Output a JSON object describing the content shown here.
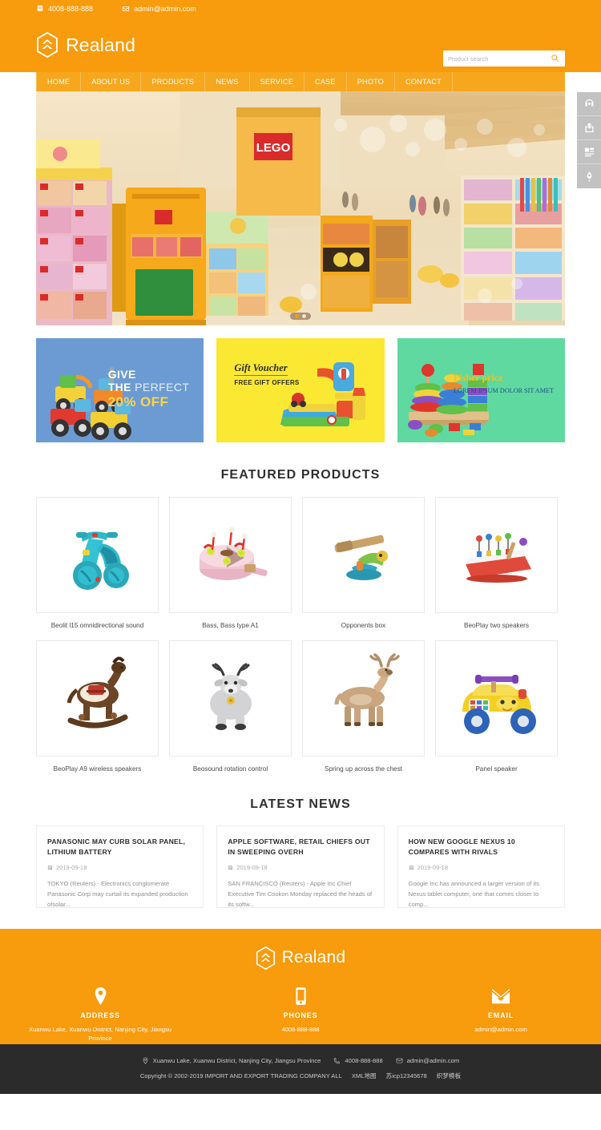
{
  "topbar": {
    "phone": "4008-888-888",
    "email": "admin@admin.com",
    "phone_icon": "telephone-icon",
    "email_icon": "envelope-icon"
  },
  "header": {
    "brand_name": "Realand",
    "logo_icon": "realand-shield-logo",
    "search": {
      "placeholder": "Product search",
      "value": "",
      "button_icon": "search-icon"
    }
  },
  "nav": {
    "items": [
      {
        "label": "HOME"
      },
      {
        "label": "ABOUT US"
      },
      {
        "label": "PRODUCTS"
      },
      {
        "label": "NEWS"
      },
      {
        "label": "SERVICE"
      },
      {
        "label": "CASE"
      },
      {
        "label": "PHOTO"
      },
      {
        "label": "CONTACT"
      }
    ]
  },
  "hero": {
    "alt": "toy store aisle with yellow LEGO display shelves",
    "slides": 2,
    "active_slide": 1
  },
  "side_tools": [
    {
      "icon": "headset-support-icon"
    },
    {
      "icon": "share-icon"
    },
    {
      "icon": "qrcode-icon"
    },
    {
      "icon": "rocket-top-icon"
    }
  ],
  "promos": [
    {
      "bg": "#6b9bd2",
      "line1_bold": "GIVE",
      "line2_bold": "THE",
      "line2_thin": " PERFECT",
      "line3": "20% OFF",
      "image": "toy-construction-trucks"
    },
    {
      "bg": "#fbe832",
      "line1": "Gift Voucher",
      "line2": "FREE GIFT OFFERS",
      "image": "toy-car-garage-playset"
    },
    {
      "bg": "#5fd9a0",
      "line1": "Fisher price",
      "line2": "LOREM IPSUM DOLOR SIT AMET",
      "image": "wooden-stacking-rings-toy"
    }
  ],
  "featured": {
    "title": "FEATURED PRODUCTS",
    "products": [
      {
        "name": "Beolit l15 omnidirectional sound",
        "image": "blue-ride-on-trike"
      },
      {
        "name": "Bass, Bass type A1",
        "image": "pink-toy-birthday-cake"
      },
      {
        "name": "Opponents box",
        "image": "wooden-seesaw-toy"
      },
      {
        "name": "BeoPlay two speakers",
        "image": "toy-xylophone-workbench"
      },
      {
        "name": "BeoPlay A9 wireless speakers",
        "image": "brown-rocking-horse"
      },
      {
        "name": "Beosound rotation control",
        "image": "grey-plush-deer"
      },
      {
        "name": "Spring up across the chest",
        "image": "wooden-reindeer-figure"
      },
      {
        "name": "Panel speaker",
        "image": "yellow-ride-on-car"
      }
    ]
  },
  "news": {
    "title": "LATEST NEWS",
    "date_icon": "calendar-icon",
    "items": [
      {
        "title": "PANASONIC MAY CURB SOLAR PANEL, LITHIUM BATTERY",
        "date": "2019-09-18",
        "desc": "TOKYO (Reuters) - Electronics conglomerate Panasonic Corp may curtail its expanded production ofsolar..."
      },
      {
        "title": "APPLE SOFTWARE, RETAIL CHIEFS OUT IN SWEEPING OVERH",
        "date": "2019-09-18",
        "desc": "SAN FRANCISCO (Reuters) - Apple Inc Chief Executive Tim Cookon Monday replaced the heads of its softw..."
      },
      {
        "title": "HOW NEW GOOGLE NEXUS 10 COMPARES WITH RIVALS",
        "date": "2019-09-18",
        "desc": "Google Inc.has announced a larger version of its Nexus tablet computer, one that comes closer to comp..."
      }
    ]
  },
  "footer": {
    "brand_name": "Realand",
    "logo_icon": "realand-shield-logo",
    "columns": [
      {
        "icon": "location-pin-icon",
        "title": "ADDRESS",
        "value": "Xuanwu Lake, Xuanwu District, Nanjing City, Jiangsu Province"
      },
      {
        "icon": "mobile-phone-icon",
        "title": "PHONES",
        "value": "4008-888-888"
      },
      {
        "icon": "envelope-icon",
        "title": "EMAIL",
        "value": "admin@admin.com"
      }
    ]
  },
  "bottombar": {
    "address": "Xuanwu Lake, Xuanwu District, Nanjing City, Jiangsu Province",
    "phone": "4008-888-888",
    "email": "admin@admin.com",
    "address_icon": "location-pin-icon",
    "phone_icon": "phone-handset-icon",
    "email_icon": "envelope-icon",
    "copyright": "Copyright © 2002-2019 IMPORT AND EXPORT TRADING COMPANY  ALL",
    "link_xml": "XML地图",
    "link_icp": "苏icp12345678",
    "link_template": "织梦模板"
  },
  "colors": {
    "brand_orange": "#f89b0c",
    "nav_orange": "#f7a71e",
    "dark": "#2b2b2b"
  }
}
